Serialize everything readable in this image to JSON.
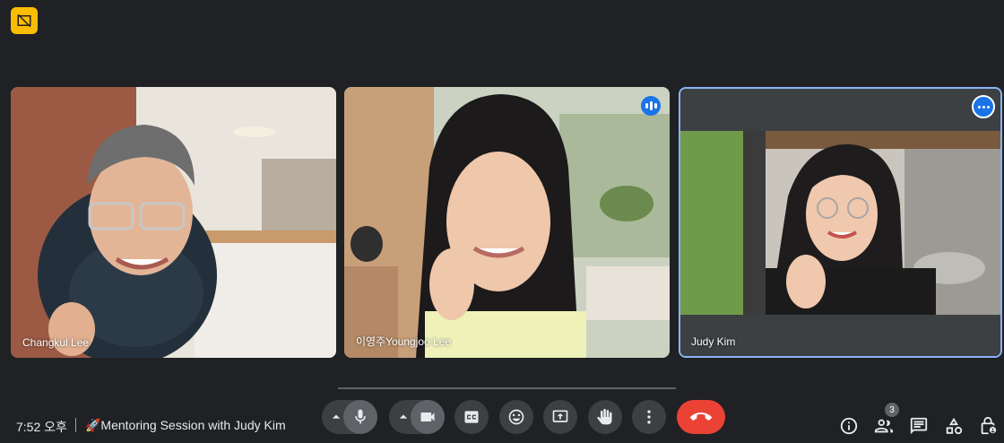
{
  "top_badge": {
    "icon": "no-layout-icon",
    "color": "#fbbc04"
  },
  "tiles": [
    {
      "name": "Changkul Lee"
    },
    {
      "name": "이영주Youngjoo Lee"
    },
    {
      "name": "Judy Kim"
    }
  ],
  "footer": {
    "time": "7:52 오후",
    "meeting_title": "🚀Mentoring Session with Judy Kim"
  },
  "controls": {
    "mic": "microphone-icon",
    "camera": "camera-icon",
    "captions": "closed-captions-icon",
    "reactions": "emoji-icon",
    "present": "present-screen-icon",
    "raise_hand": "raise-hand-icon",
    "more": "more-options-icon",
    "end_call": "end-call-icon"
  },
  "right_panel": {
    "people_count": "3"
  },
  "colors": {
    "end_call": "#ea4335",
    "accent": "#1a73e8",
    "active_border": "#8ab4f8"
  }
}
